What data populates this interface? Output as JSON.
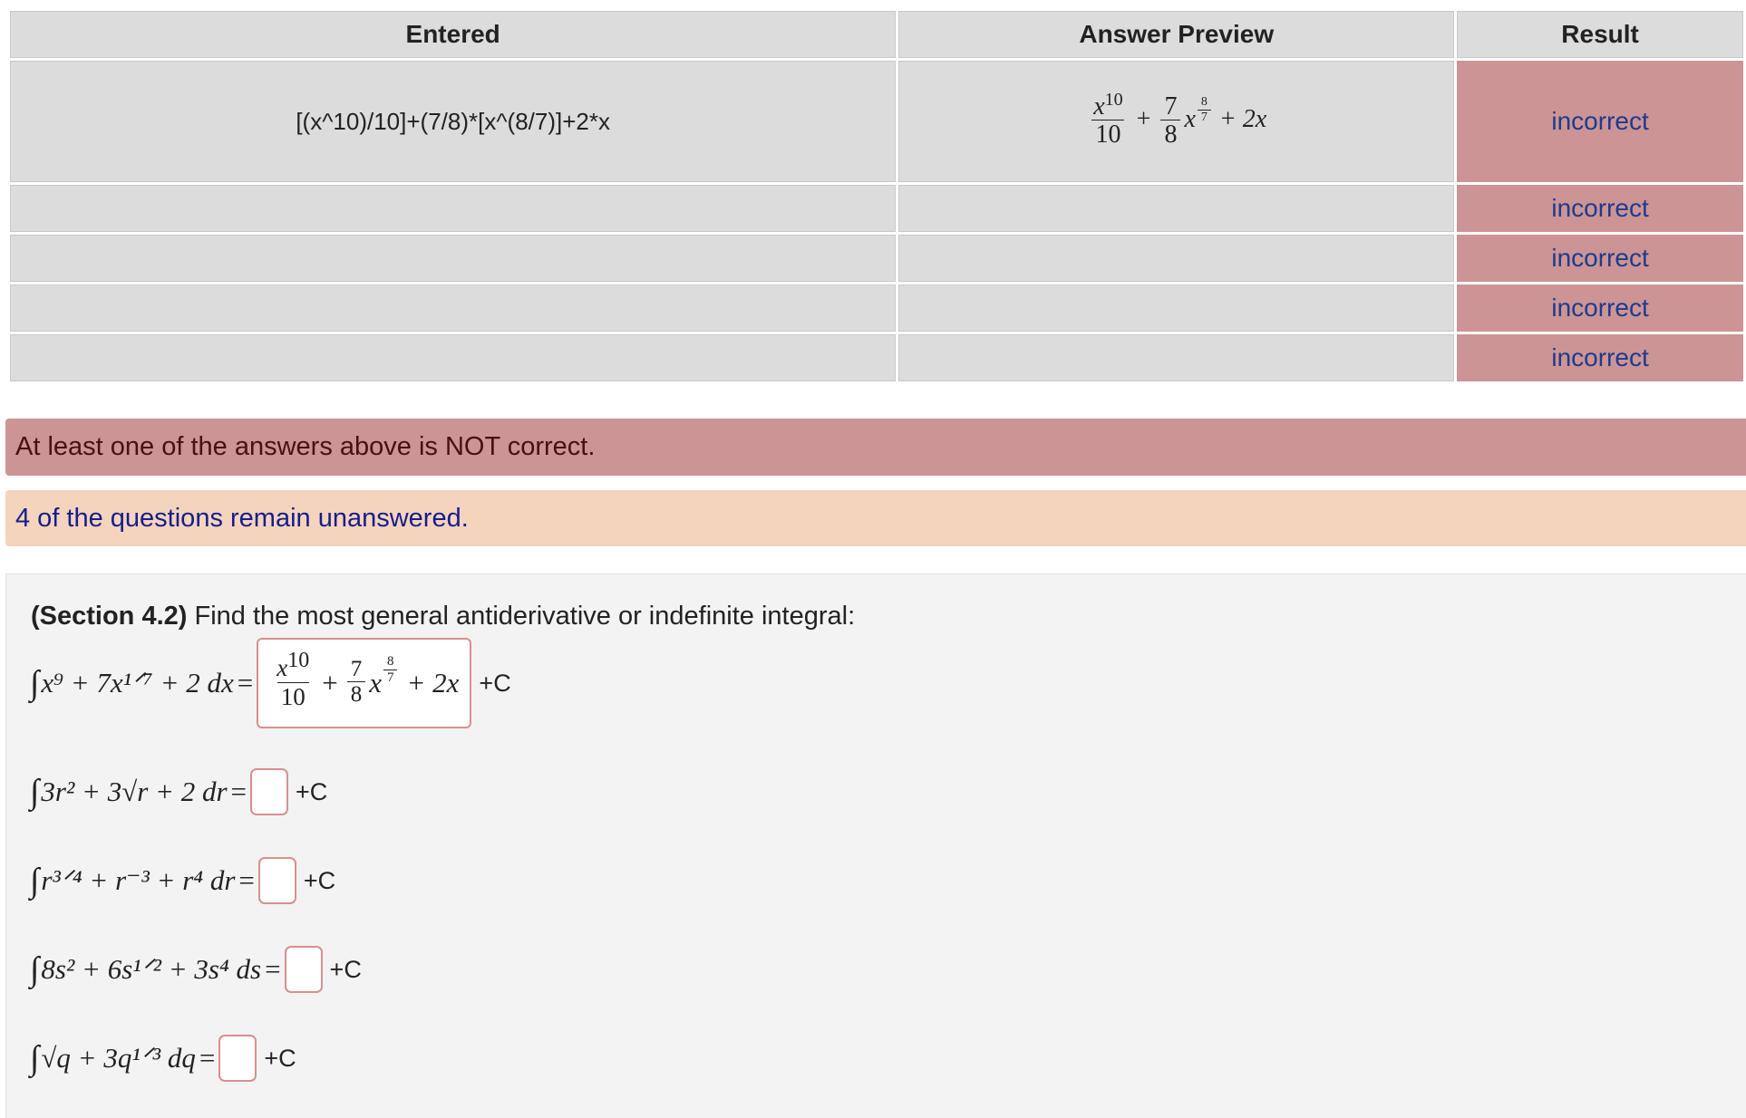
{
  "table": {
    "headers": [
      "Entered",
      "Answer Preview",
      "Result"
    ],
    "rows": [
      {
        "entered": "[(x^10)/10]+(7/8)*[x^(8/7)]+2*x",
        "result": "incorrect"
      },
      {
        "entered": "",
        "result": "incorrect"
      },
      {
        "entered": "",
        "result": "incorrect"
      },
      {
        "entered": "",
        "result": "incorrect"
      },
      {
        "entered": "",
        "result": "incorrect"
      }
    ],
    "preview": {
      "num1": "x",
      "num1_exp": "10",
      "den1": "10",
      "plus": "+",
      "num2": "7",
      "den2": "8",
      "var2": "x",
      "exp2_num": "8",
      "exp2_den": "7",
      "tail": "+ 2x"
    }
  },
  "banners": {
    "error": "At least one of the answers above is NOT correct.",
    "warning": "4 of the questions remain unanswered."
  },
  "problem": {
    "section_label": "(Section 4.2)",
    "prompt": "Find the most general antiderivative or indefinite integral:",
    "integrals": [
      {
        "lhs": "x⁹ + 7x¹ᐟ⁷ + 2 dx",
        "plus_c": "+C"
      },
      {
        "lhs": "3r² + 3√r + 2 dr",
        "plus_c": "+C"
      },
      {
        "lhs": "r³ᐟ⁴ + r⁻³ + r⁴ dr",
        "plus_c": "+C"
      },
      {
        "lhs": "8s² + 6s¹ᐟ² + 3s⁴ ds",
        "plus_c": "+C"
      },
      {
        "lhs": "√q + 3q¹ᐟ³ dq",
        "plus_c": "+C"
      }
    ],
    "integral_sign": "∫",
    "equals": "="
  }
}
